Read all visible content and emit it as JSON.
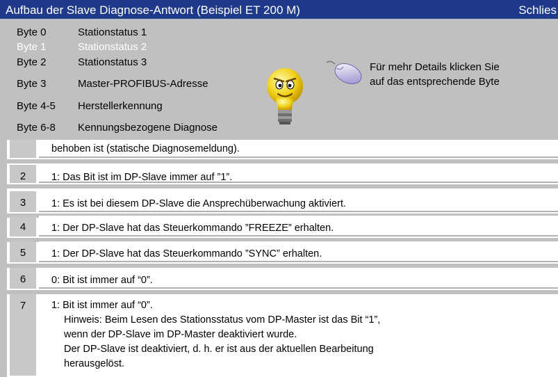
{
  "window": {
    "title": "Aufbau der Slave Diagnose-Antwort (Beispiel ET 200 M)",
    "close_label": "Schlies"
  },
  "bytes": [
    {
      "label": "Byte 0",
      "desc": "Stationstatus 1",
      "selected": false
    },
    {
      "label": "Byte 1",
      "desc": "Stationstatus 2",
      "selected": true
    },
    {
      "label": "Byte 2",
      "desc": "Stationstatus 3",
      "selected": false
    },
    {
      "label": "Byte 3",
      "desc": "Master-PROFIBUS-Adresse",
      "selected": false
    },
    {
      "label": "Byte 4-5",
      "desc": "Herstellerkennung",
      "selected": false
    },
    {
      "label": "Byte 6-8",
      "desc": "Kennungsbezogene Diagnose",
      "selected": false
    }
  ],
  "hint": {
    "line1": "Für mehr Details klicken Sie",
    "line2": "auf das entsprechende Byte"
  },
  "icons": {
    "mascot": "lightbulb-face-icon",
    "mouse": "mouse-icon"
  },
  "colors": {
    "titlebar": "#1f3a8a",
    "background": "#c0c0c0",
    "selected_text": "#ffffff"
  },
  "table": [
    {
      "bit": "",
      "lines": [
        "behoben ist (statische Diagnosemeldung)."
      ]
    },
    {
      "bit": "2",
      "lines": [
        "1: Das Bit ist im DP-Slave immer auf ”1”."
      ]
    },
    {
      "bit": "3",
      "lines": [
        "1: Es ist bei diesem DP-Slave die Ansprechüberwachung aktiviert."
      ]
    },
    {
      "bit": "4",
      "lines": [
        "1: Der DP-Slave hat das Steuerkommando ”FREEZE” erhalten."
      ]
    },
    {
      "bit": "5",
      "lines": [
        " 1: Der DP-Slave hat das Steuerkommando ”SYNC” erhalten."
      ]
    },
    {
      "bit": "6",
      "lines": [
        " 0: Bit ist immer auf “0”."
      ]
    },
    {
      "bit": "7",
      "lines": [
        "1: Bit ist immer auf “0”.",
        "Hinweis: Beim Lesen des Stationsstatus vom DP-Master ist das Bit “1”,",
        "wenn der DP-Slave im DP-Master deaktiviert wurde.",
        "Der DP-Slave ist deaktiviert, d. h. er ist aus der aktuellen Bearbeitung",
        "herausgelöst."
      ]
    }
  ]
}
